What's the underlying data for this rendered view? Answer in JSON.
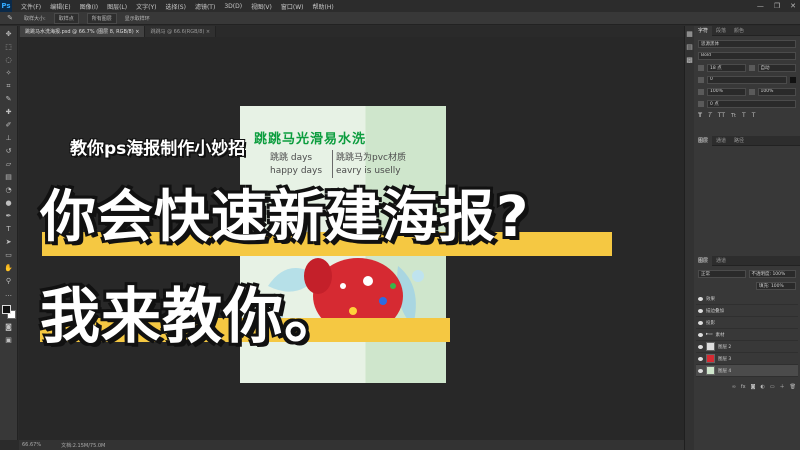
{
  "app": {
    "logo": "Ps"
  },
  "menu": [
    "文件(F)",
    "编辑(E)",
    "图像(I)",
    "图层(L)",
    "文字(Y)",
    "选择(S)",
    "滤镜(T)",
    "3D(D)",
    "视图(V)",
    "窗口(W)",
    "帮助(H)"
  ],
  "window_controls": [
    "—",
    "❐",
    "✕"
  ],
  "options_bar": {
    "chip1": "取样大小:",
    "chip2": "取样点",
    "chip3": "所有图层",
    "text1": "显示取样环"
  },
  "tabs": [
    {
      "label": "跳跳马水洗海报.psd @ 66.7% (图层 8, RGB/8) ×"
    },
    {
      "label": "跳跳马 @ 66.6(RGB/8) ×"
    }
  ],
  "status": {
    "zoom": "66.67%",
    "doc": "文档:2.15M/75.0M"
  },
  "panels": {
    "top_tabs": [
      "字符",
      "段落",
      "颜色"
    ],
    "char_fields": [
      "思源黑体",
      "Bold",
      "18 点",
      "自动",
      "0",
      "100%",
      "100%",
      "0 点"
    ],
    "middle_tabs": [
      "图层",
      "通道",
      "路径"
    ],
    "layer_tabs": [
      "图层",
      "通道"
    ],
    "blend_mode": "正常",
    "opacity": "不透明度: 100%",
    "fill": "填充: 100%",
    "layers": [
      "效果",
      "描边叠加",
      "投影",
      "素材",
      "图层 2",
      "图层 3",
      "图层 4"
    ]
  },
  "poster": {
    "title": "跳跳马光滑易水洗",
    "line1": "跳跳 days",
    "line2": "happy days",
    "line3": "跳跳马为pvc材质",
    "line4": "eavry is uselly"
  },
  "overlay": {
    "subtitle": "教你ps海报制作小妙招",
    "headline": "你会快速新建海报?",
    "headline2": "我来教你。"
  },
  "colors": {
    "accent_yellow": "#f5c842",
    "poster_green": "#0c9d3e"
  }
}
